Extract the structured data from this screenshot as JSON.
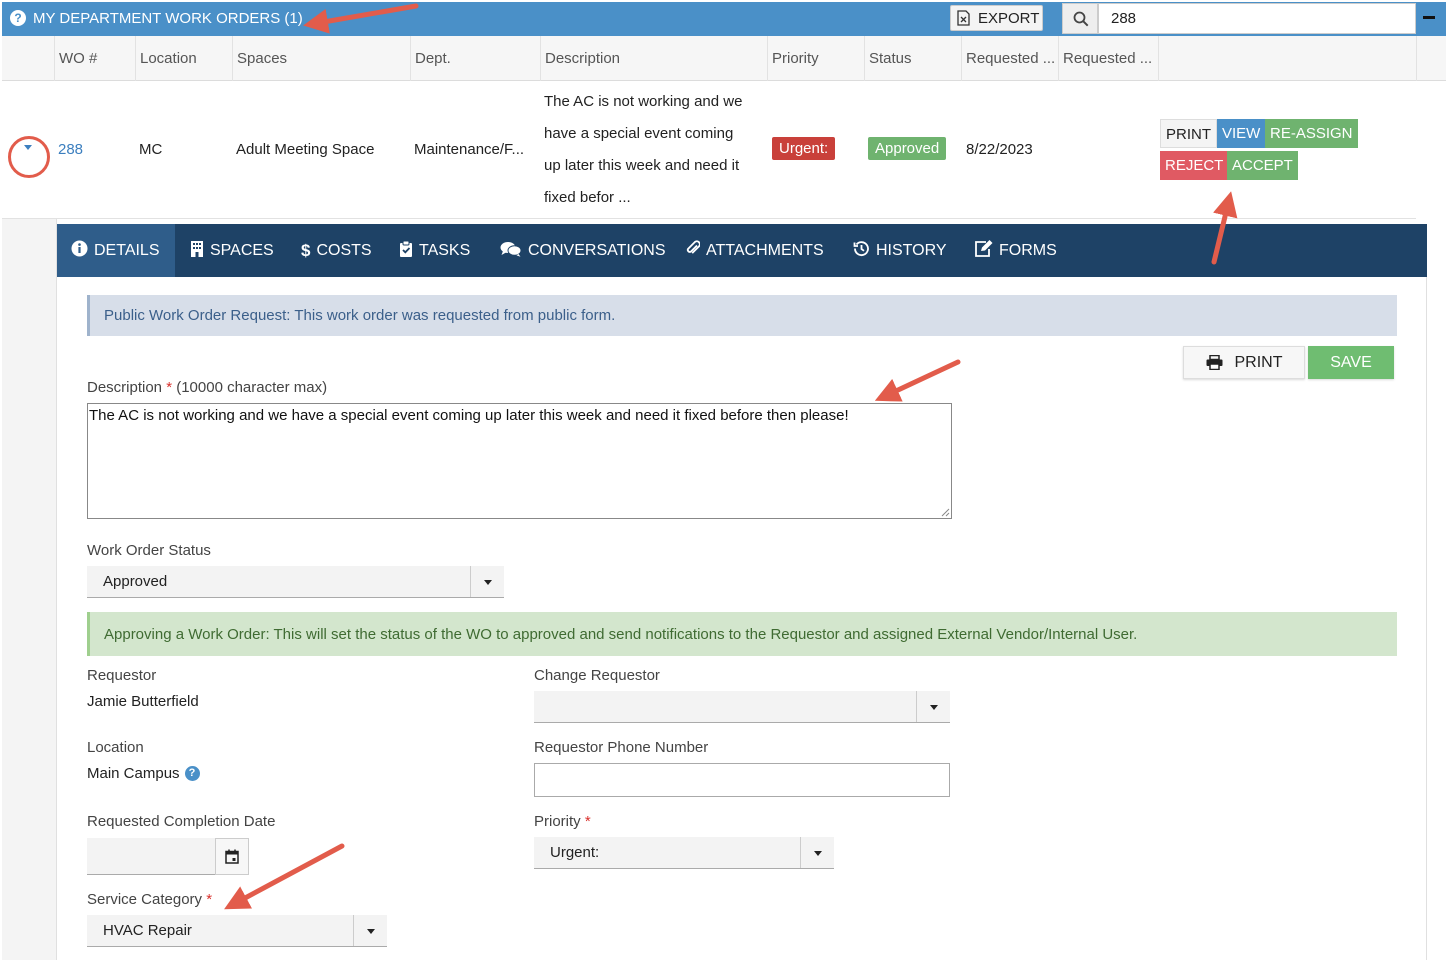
{
  "header": {
    "title": "MY DEPARTMENT WORK ORDERS (1)",
    "export_label": "EXPORT",
    "search_value": "288"
  },
  "grid": {
    "columns": [
      "WO #",
      "Location",
      "Spaces",
      "Dept.",
      "Description",
      "Priority",
      "Status",
      "Requested ...",
      "Requested ..."
    ],
    "row": {
      "wo": "288",
      "location": "MC",
      "spaces": "Adult Meeting Space",
      "dept": "Maintenance/F...",
      "description_lines": [
        "The AC is not working and we",
        "have a special event coming",
        "up later this week and need it",
        "fixed befor ..."
      ],
      "priority": "Urgent:",
      "status": "Approved",
      "requested_date": "8/22/2023",
      "actions": {
        "print": "PRINT",
        "view": "VIEW",
        "reassign": "RE-ASSIGN",
        "reject": "REJECT",
        "accept": "ACCEPT"
      }
    }
  },
  "tabs": [
    {
      "label": "DETAILS",
      "icon": "info-icon"
    },
    {
      "label": "SPACES",
      "icon": "building-icon"
    },
    {
      "label": "COSTS",
      "icon": "dollar-icon"
    },
    {
      "label": "TASKS",
      "icon": "clipboard-check-icon"
    },
    {
      "label": "CONVERSATIONS",
      "icon": "comments-icon"
    },
    {
      "label": "ATTACHMENTS",
      "icon": "paperclip-icon"
    },
    {
      "label": "HISTORY",
      "icon": "history-icon"
    },
    {
      "label": "FORMS",
      "icon": "edit-icon"
    }
  ],
  "details": {
    "public_notice": "Public Work Order Request: This work order was requested from public form.",
    "print_label": "PRINT",
    "save_label": "SAVE",
    "description_label": "Description",
    "description_required": "*",
    "description_hint": "(10000 character max)",
    "description_value": "The AC is not working and we have a special event coming up later this week and need it fixed before then please!",
    "status_label": "Work Order Status",
    "status_value": "Approved",
    "approving_notice": "Approving a Work Order: This will set the status of the WO to approved and send notifications to the Requestor and assigned External Vendor/Internal User.",
    "requestor_label": "Requestor",
    "requestor_value": "Jamie Butterfield",
    "change_requestor_label": "Change Requestor",
    "change_requestor_value": "",
    "location_label": "Location",
    "location_value": "Main Campus",
    "phone_label": "Requestor Phone Number",
    "phone_value": "",
    "completion_label": "Requested Completion Date",
    "completion_value": "",
    "priority_label": "Priority",
    "priority_required": "*",
    "priority_value": "Urgent:",
    "service_label": "Service Category",
    "service_required": "*",
    "service_value": "HVAC Repair"
  },
  "colors": {
    "header_blue": "#4a90c8",
    "tabs_navy": "#1e4266",
    "urgent_red": "#c9403a",
    "approved_green": "#6fb36f",
    "annotation_red": "#e25c4b"
  }
}
